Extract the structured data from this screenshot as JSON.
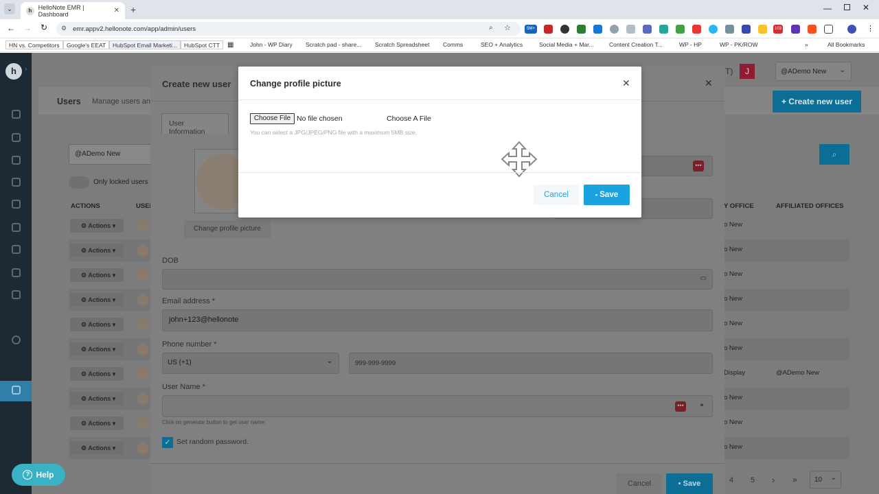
{
  "browser": {
    "tab_title": "HelloNote EMR | Dashboard",
    "url": "emr.appv2.hellonote.com/app/admin/users",
    "bookmarks": [
      "HN vs. Competitors",
      "Google's EEAT",
      "HubSpot Email Marketi...",
      "HubSpot CTT",
      "John - WP Diary",
      "Scratch pad - share...",
      "Scratch Spreadsheet",
      "Comms",
      "SEO + Analytics",
      "Social Media + Mar...",
      "Content Creation T...",
      "WP - HP",
      "WP - PK/ROW",
      "All Bookmarks"
    ],
    "ext_badge_5m": "5M+",
    "ext_badge_103": "103"
  },
  "header": {
    "avatar_letter": "J",
    "office_select": "@ADemo New",
    "paren_text": "T)"
  },
  "users_page": {
    "title": "Users",
    "subtitle": "Manage users and",
    "create_button": "+ Create new user",
    "filter_value": "@ADemo New",
    "locked_toggle_label": "Only locked users",
    "col_actions": "ACTIONS",
    "col_user": "USER",
    "col_primary_office": "Y OFFICE",
    "col_affiliated": "AFFILIATED OFFICES",
    "action_label": "Actions",
    "rows": [
      {
        "primary": "o New",
        "affiliated": ""
      },
      {
        "primary": "o New",
        "affiliated": ""
      },
      {
        "primary": "o New",
        "affiliated": ""
      },
      {
        "primary": "o New",
        "affiliated": ""
      },
      {
        "primary": "o New",
        "affiliated": ""
      },
      {
        "primary": "o New",
        "affiliated": ""
      },
      {
        "primary": "Display",
        "affiliated": "@ADemo New"
      },
      {
        "primary": "o New",
        "affiliated": ""
      },
      {
        "primary": "o New",
        "affiliated": ""
      },
      {
        "primary": "o New",
        "affiliated": ""
      }
    ],
    "pagination": [
      "4",
      "5",
      "›",
      "»"
    ],
    "page_size": "10"
  },
  "create_modal": {
    "title": "Create new user",
    "tab_user_info": "User Information",
    "change_picture_button": "Change profile picture",
    "dob_label": "DOB",
    "email_label": "Email address *",
    "email_value": "john+123@hellonote",
    "phone_label": "Phone number *",
    "country_code": "US (+1)",
    "phone_placeholder": "999-999-9999",
    "username_label": "User Name *",
    "username_hint": "Click on generate button to get user name:",
    "random_password_label": "Set random password.",
    "cancel": "Cancel",
    "save": "Save"
  },
  "picture_modal": {
    "title": "Change profile picture",
    "choose_file": "Choose File",
    "no_file": "No file chosen",
    "choose_a_file": "Choose A File",
    "hint": "You can select a JPG/JPEG/PNG file with a maximum 5MB size.",
    "cancel": "Cancel",
    "save": "Save"
  },
  "help": {
    "label": "Help"
  },
  "colors": {
    "accent": "#1ba3e0",
    "sidebar": "#1e2a33",
    "danger": "#d32f2f"
  }
}
